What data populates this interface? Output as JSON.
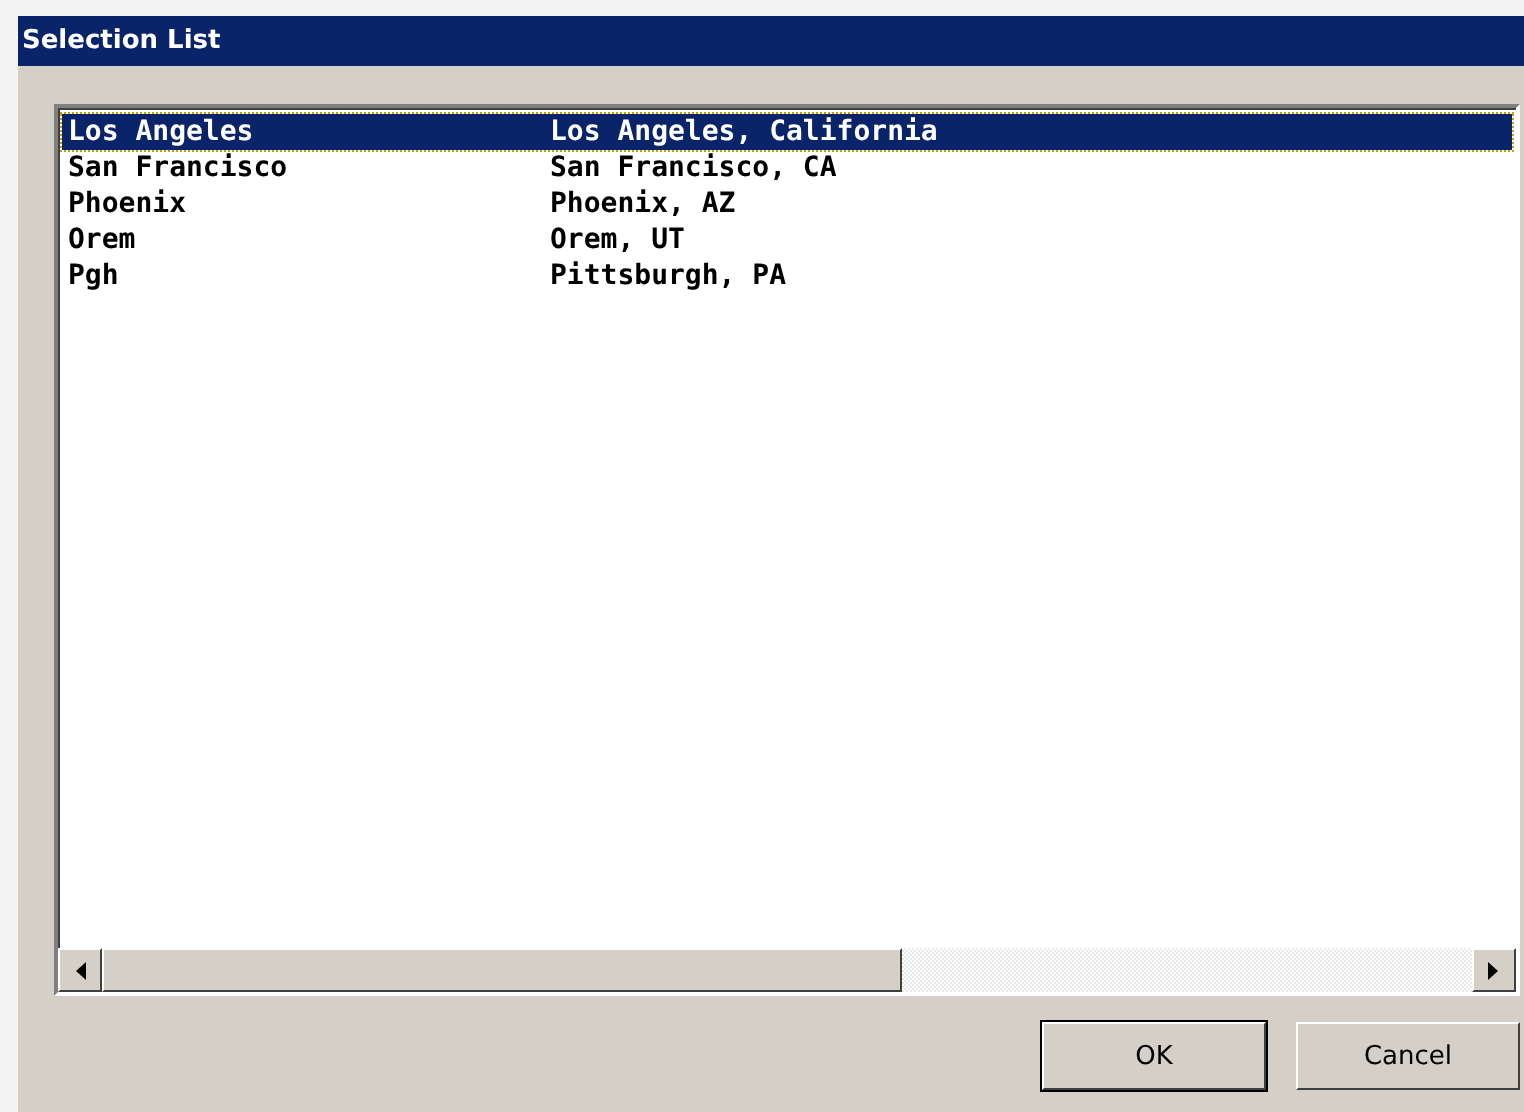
{
  "window": {
    "title": "Selection List"
  },
  "list": {
    "rows": [
      {
        "name": "Los Angeles",
        "location": "Los Angeles, California",
        "selected": true
      },
      {
        "name": "San Francisco",
        "location": "San Francisco, CA",
        "selected": false
      },
      {
        "name": "Phoenix",
        "location": "Phoenix, AZ",
        "selected": false
      },
      {
        "name": "Orem",
        "location": "Orem, UT",
        "selected": false
      },
      {
        "name": "Pgh",
        "location": "Pittsburgh, PA",
        "selected": false
      }
    ]
  },
  "buttons": [
    {
      "label": "OK",
      "kind": "default"
    },
    {
      "label": "Cancel",
      "kind": "normal"
    }
  ]
}
